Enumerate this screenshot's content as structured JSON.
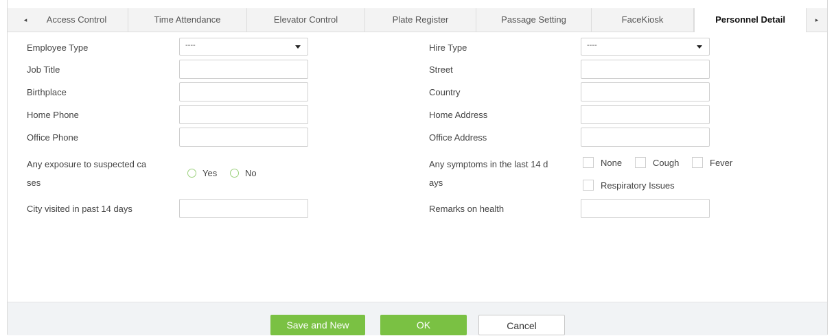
{
  "tabs": {
    "prev_arrow": "◂",
    "next_arrow": "▸",
    "items": [
      {
        "label": "Access Control"
      },
      {
        "label": "Time Attendance"
      },
      {
        "label": "Elevator Control"
      },
      {
        "label": "Plate Register"
      },
      {
        "label": "Passage Setting"
      },
      {
        "label": "FaceKiosk"
      },
      {
        "label": "Personnel Detail",
        "active": true
      }
    ]
  },
  "form": {
    "employee_type": {
      "label": "Employee Type",
      "value": "----"
    },
    "hire_type": {
      "label": "Hire Type",
      "value": "----"
    },
    "job_title": {
      "label": "Job Title",
      "value": ""
    },
    "street": {
      "label": "Street",
      "value": ""
    },
    "birthplace": {
      "label": "Birthplace",
      "value": ""
    },
    "country": {
      "label": "Country",
      "value": ""
    },
    "home_phone": {
      "label": "Home Phone",
      "value": ""
    },
    "home_address": {
      "label": "Home Address",
      "value": ""
    },
    "office_phone": {
      "label": "Office Phone",
      "value": ""
    },
    "office_address": {
      "label": "Office Address",
      "value": ""
    },
    "exposure": {
      "label_line1": "Any exposure to suspected ca",
      "label_line2": "ses",
      "options": [
        "Yes",
        "No"
      ]
    },
    "symptoms": {
      "label_line1": "Any symptoms in the last 14 d",
      "label_line2": "ays",
      "options": [
        "None",
        "Cough",
        "Fever",
        "Respiratory Issues"
      ]
    },
    "city_visited": {
      "label": "City visited in past 14 days",
      "value": ""
    },
    "remarks_health": {
      "label": "Remarks on health",
      "value": ""
    }
  },
  "footer": {
    "save_new": "Save and New",
    "ok": "OK",
    "cancel": "Cancel"
  },
  "colors": {
    "accent_green": "#7ac143",
    "radio_border": "#9ad07a"
  }
}
